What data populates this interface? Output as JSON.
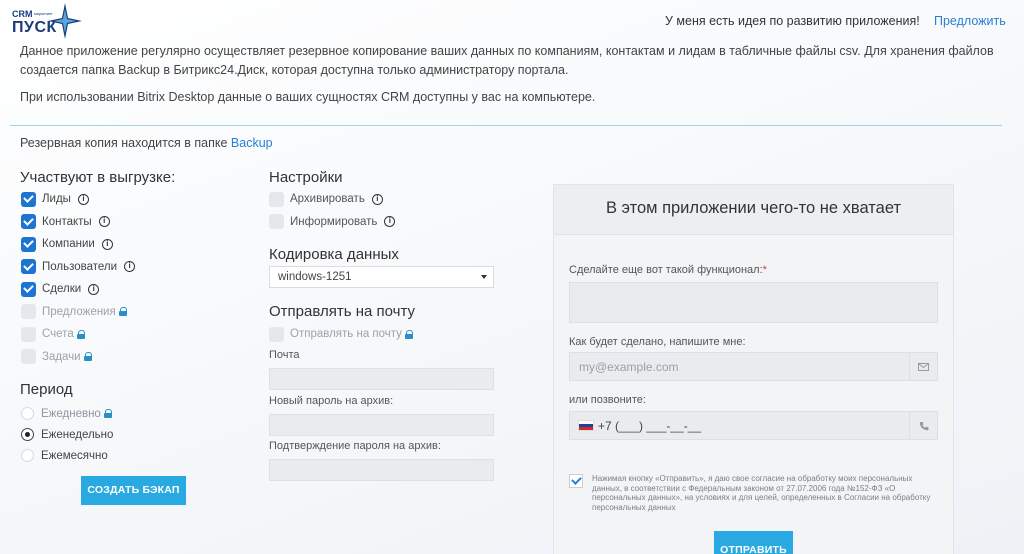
{
  "header": {
    "logo_top": "CRM",
    "logo_small": "маркетинг",
    "logo_main": "ПУСК",
    "idea_text": "У меня есть идея по развитию приложения!",
    "idea_link": "Предложить"
  },
  "intro": {
    "paragraph1": "Данное приложение регулярно осуществляет резервное копирование ваших данных по компаниям, контактам и лидам в табличные файлы csv. Для хранения файлов создается папка Backup в Битрикс24.Диск, которая доступна только администратору портала.",
    "paragraph2": "При использовании Bitrix Desktop данные о ваших сущностях CRM доступны у вас на компьютере.",
    "backup_prefix": "Резервная копия находится в папке",
    "backup_link": "Backup"
  },
  "export": {
    "title": "Участвуют в выгрузке:",
    "items": [
      {
        "label": "Лиды",
        "checked": true
      },
      {
        "label": "Контакты",
        "checked": true
      },
      {
        "label": "Компании",
        "checked": true
      },
      {
        "label": "Пользователи",
        "checked": true
      },
      {
        "label": "Сделки",
        "checked": true
      },
      {
        "label": "Предложения",
        "checked": false
      },
      {
        "label": "Счета",
        "checked": false
      },
      {
        "label": "Задачи",
        "checked": false
      }
    ]
  },
  "period": {
    "title": "Период",
    "options": [
      {
        "label": "Ежедневно",
        "selected": false
      },
      {
        "label": "Еженедельно",
        "selected": true
      },
      {
        "label": "Ежемесячно",
        "selected": false
      }
    ]
  },
  "create_button": "СОЗДАТЬ БЭКАП",
  "settings": {
    "title": "Настройки",
    "archive": "Архивировать",
    "inform": "Информировать",
    "encoding_title": "Кодировка данных",
    "encoding_value": "windows-1251",
    "mail_title": "Отправлять на почту",
    "mail_checkbox": "Отправлять на почту",
    "email_label": "Почта",
    "password_label": "Новый пароль на архив:",
    "confirm_label": "Подтверждение пароля на архив:"
  },
  "feedback": {
    "title": "В этом приложении чего-то не хватает",
    "feature_label": "Сделайте еще вот такой функционал:",
    "required_mark": "*",
    "email_label": "Как будет сделано, напишите мне:",
    "email_placeholder": "my@example.com",
    "phone_label": "или позвоните:",
    "phone_value": "+7 (___) ___-__-__",
    "consent": "Нажимая кнопку «Отправить», я даю свое согласие на обработку моих персональных данных, в соответствии с Федеральным законом от 27.07.2006 года №152-ФЗ «О персональных данных», на условиях и для целей, определенных в Согласии на обработку персональных данных",
    "submit": "ОТПРАВИТЬ"
  },
  "colors": {
    "accent": "#29a9e1",
    "checkbox": "#1e74d3",
    "link": "#2a7fd4",
    "lock": "#2a8fc8"
  }
}
